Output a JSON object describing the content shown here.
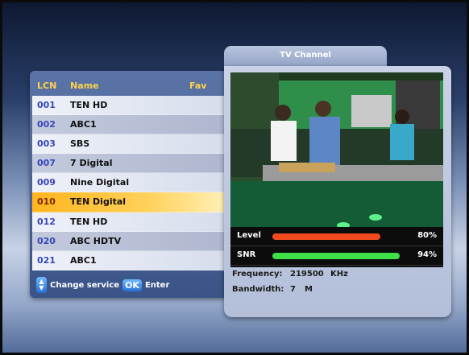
{
  "list": {
    "header": {
      "lcn": "LCN",
      "name": "Name",
      "fav": "Fav"
    },
    "rows": [
      {
        "lcn": "001",
        "name": "TEN HD"
      },
      {
        "lcn": "002",
        "name": "ABC1"
      },
      {
        "lcn": "003",
        "name": "SBS"
      },
      {
        "lcn": "007",
        "name": "7 Digital"
      },
      {
        "lcn": "009",
        "name": "Nine Digital"
      },
      {
        "lcn": "010",
        "name": "TEN Digital"
      },
      {
        "lcn": "012",
        "name": "TEN HD"
      },
      {
        "lcn": "020",
        "name": "ABC HDTV"
      },
      {
        "lcn": "021",
        "name": "ABC1"
      }
    ],
    "selected_index": 5,
    "hint": {
      "change": "Change service",
      "ok": "OK",
      "enter": "Enter"
    }
  },
  "tv": {
    "title": "TV Channel",
    "level": {
      "label": "Level",
      "value": "80%",
      "fraction": 0.8,
      "color": "#f04a1e"
    },
    "snr": {
      "label": "SNR",
      "value": "94%",
      "fraction": 0.94,
      "color": "#3ee04a"
    },
    "frequency": {
      "label": "Frequency:",
      "value": "219500",
      "unit": "KHz"
    },
    "bandwidth": {
      "label": "Bandwidth:",
      "value": "7",
      "unit": "M"
    }
  }
}
